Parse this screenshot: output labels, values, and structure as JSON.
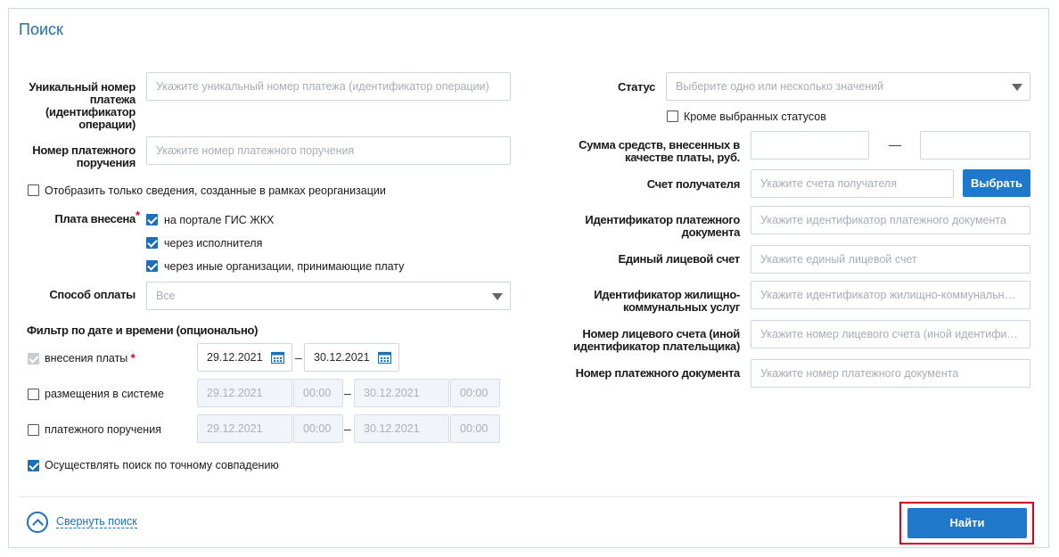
{
  "title": "Поиск",
  "left": {
    "unique_number": {
      "label": "Уникальный номер платежа (идентификатор операции)",
      "placeholder": "Укажите уникальный номер платежа (идентификатор операции)"
    },
    "order_number": {
      "label": "Номер платежного поручения",
      "placeholder": "Укажите номер платежного поручения"
    },
    "reorg_checkbox": {
      "label": "Отобразить только сведения, созданные в рамках реорганизации",
      "checked": false
    },
    "paid_via": {
      "label": "Плата внесена",
      "required_mark": "*",
      "options": [
        {
          "label": "на портале ГИС ЖКХ",
          "checked": true
        },
        {
          "label": "через исполнителя",
          "checked": true
        },
        {
          "label": "через иные организации, принимающие плату",
          "checked": true
        }
      ]
    },
    "payment_method": {
      "label": "Способ оплаты",
      "value": "Все"
    },
    "date_filter": {
      "heading": "Фильтр по дате и времени (опционально)",
      "rows": [
        {
          "label": "внесения платы",
          "required_mark": "*",
          "checked": true,
          "disabled": true,
          "from": "29.12.2021",
          "to": "30.12.2021"
        },
        {
          "label": "размещения в системе",
          "checked": false,
          "from": "29.12.2021",
          "from_time": "00:00",
          "to": "30.12.2021",
          "to_time": "00:00"
        },
        {
          "label": "платежного поручения",
          "checked": false,
          "from": "29.12.2021",
          "from_time": "00:00",
          "to": "30.12.2021",
          "to_time": "00:00"
        }
      ],
      "range_sep": "–"
    },
    "exact_match": {
      "label": "Осуществлять поиск по точному совпадению",
      "checked": true
    }
  },
  "right": {
    "status": {
      "label": "Статус",
      "placeholder": "Выберите одно или несколько значений"
    },
    "except_status": {
      "label": "Кроме выбранных статусов",
      "checked": false
    },
    "amount": {
      "label": "Сумма средств, внесенных в качестве платы, руб.",
      "from": "",
      "to": "",
      "sep": "—"
    },
    "recipient_account": {
      "label": "Счет получателя",
      "placeholder": "Укажите счета получателя",
      "button": "Выбрать"
    },
    "payment_doc_id": {
      "label": "Идентификатор платежного документа",
      "placeholder": "Укажите идентификатор платежного документа"
    },
    "single_account": {
      "label": "Единый лицевой счет",
      "placeholder": "Укажите единый лицевой счет"
    },
    "housing_service_id": {
      "label": "Идентификатор жилищно-коммунальных услуг",
      "placeholder": "Укажите идентификатор жилищно-коммунальных услуг"
    },
    "personal_account": {
      "label": "Номер лицевого счета (иной идентификатор плательщика)",
      "placeholder": "Укажите номер лицевого счета (иной идентификатор плательщика)"
    },
    "payment_doc_number": {
      "label": "Номер платежного документа",
      "placeholder": "Укажите номер платежного документа"
    }
  },
  "footer": {
    "collapse_label": "Свернуть поиск",
    "find_button": "Найти"
  },
  "colors": {
    "accent": "#1f78c9",
    "title": "#1f6fb5",
    "highlight": "#d6001c"
  },
  "icons": {
    "calendar": "calendar-icon",
    "dropdown": "chevron-down-icon",
    "collapse": "chevron-up-circle-icon"
  }
}
